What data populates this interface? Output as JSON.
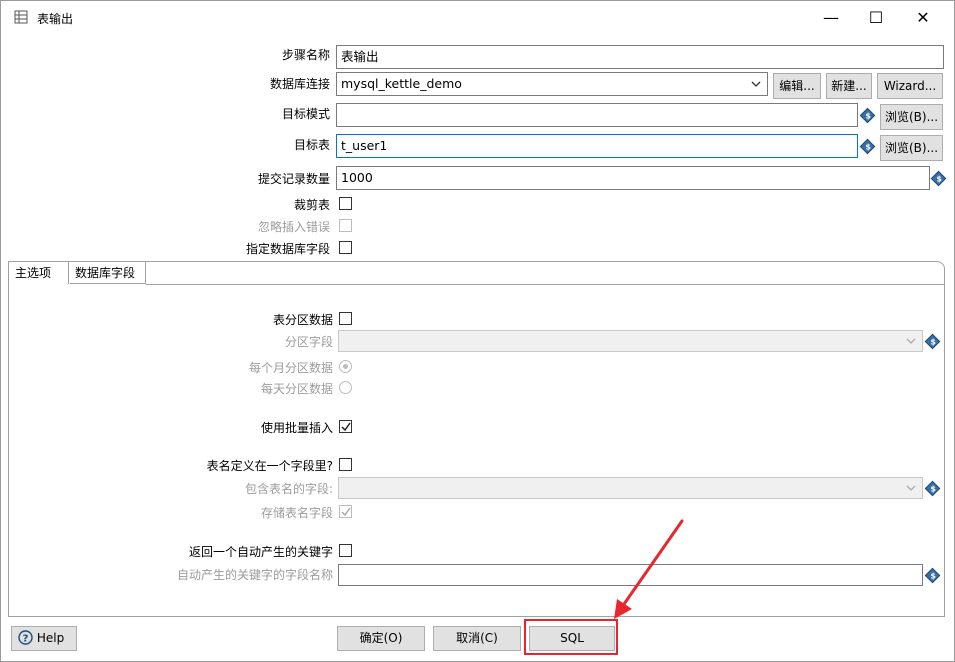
{
  "window": {
    "title": "表输出",
    "minimize_glyph": "—",
    "maximize_glyph": "☐",
    "close_glyph": "✕"
  },
  "form": {
    "step_name_label": "步骤名称",
    "step_name_value": "表输出",
    "connection_label": "数据库连接",
    "connection_value": "mysql_kettle_demo",
    "edit_button": "编辑...",
    "new_button": "新建...",
    "wizard_button": "Wizard...",
    "target_schema_label": "目标模式",
    "target_schema_value": "",
    "browse_button_1": "浏览(B)...",
    "target_table_label": "目标表",
    "target_table_value": "t_user1",
    "browse_button_2": "浏览(B)...",
    "commit_size_label": "提交记录数量",
    "commit_size_value": "1000",
    "truncate_label": "裁剪表",
    "truncate_checked": false,
    "ignore_errors_label": "忽略插入错误",
    "ignore_errors_checked": false,
    "specify_fields_label": "指定数据库字段",
    "specify_fields_checked": false
  },
  "tabs": [
    {
      "label": "主选项",
      "active": true
    },
    {
      "label": "数据库字段",
      "active": false
    }
  ],
  "main_tab": {
    "partition_label": "表分区数据",
    "partition_checked": false,
    "partition_field_label": "分区字段",
    "partition_field_value": "",
    "monthly_label": "每个月分区数据",
    "monthly_selected": true,
    "daily_label": "每天分区数据",
    "daily_selected": false,
    "batch_insert_label": "使用批量插入",
    "batch_insert_checked": true,
    "table_name_in_field_label": "表名定义在一个字段里?",
    "table_name_in_field_checked": false,
    "table_name_field_label": "包含表名的字段:",
    "table_name_field_value": "",
    "store_table_name_label": "存储表名字段",
    "store_table_name_checked": true,
    "return_key_label": "返回一个自动产生的关键字",
    "return_key_checked": false,
    "key_field_name_label": "自动产生的关键字的字段名称",
    "key_field_name_value": ""
  },
  "footer": {
    "help_button": "Help",
    "ok_button": "确定(O)",
    "cancel_button": "取消(C)",
    "sql_button": "SQL"
  },
  "colors": {
    "highlight": "#e8262c",
    "focus_border": "#0078d7",
    "variable_icon": "#3a6ea5"
  }
}
